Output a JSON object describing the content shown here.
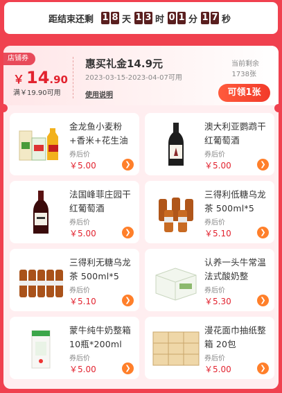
{
  "countdown": {
    "prefix": "距结束还剩",
    "day_digits": [
      "1",
      "8"
    ],
    "day_unit": "天",
    "hour_digits": [
      "1",
      "3"
    ],
    "hour_unit": "时",
    "min_digits": [
      "0",
      "1"
    ],
    "min_unit": "分",
    "sec_digits": [
      "1",
      "7"
    ],
    "sec_unit": "秒"
  },
  "coupon": {
    "tag": "店铺券",
    "currency": "￥",
    "amount_int": "14",
    "amount_dec": ".90",
    "min_use": "满￥19.90可用",
    "title": "惠买礼金14.9元",
    "date_range": "2023-03-15-2023-04-07可用",
    "usage_link": "使用说明",
    "remain_label": "当前剩余",
    "remain_count": "1738张",
    "claim_label": "可领1张"
  },
  "products": [
    {
      "name": "金龙鱼小麦粉+香米+花生油",
      "price_label": "券后价",
      "price": "￥5.00",
      "icon": "grain-oil-bundle"
    },
    {
      "name": "澳大利亚鹦鹉干红葡萄酒",
      "price_label": "券后价",
      "price": "￥5.00",
      "icon": "wine-bottle"
    },
    {
      "name": "法国峰菲庄园干红葡萄酒",
      "price_label": "券后价",
      "price": "￥5.00",
      "icon": "wine-bottle"
    },
    {
      "name": "三得利低糖乌龙茶 500ml*5",
      "price_label": "券后价",
      "price": "￥5.10",
      "icon": "tea-bottles"
    },
    {
      "name": "三得利无糖乌龙茶 500ml*5",
      "price_label": "券后价",
      "price": "￥5.10",
      "icon": "tea-bottles"
    },
    {
      "name": "认养一头牛常温法式酸奶整",
      "price_label": "券后价",
      "price": "￥5.30",
      "icon": "yogurt-box"
    },
    {
      "name": "蒙牛纯牛奶整箱 10瓶*200ml",
      "price_label": "券后价",
      "price": "￥5.00",
      "icon": "milk-box"
    },
    {
      "name": "漫花面巾抽纸整箱 20包",
      "price_label": "券后价",
      "price": "￥5.00",
      "icon": "tissue-pack"
    }
  ],
  "colors": {
    "page_bg": "#f0414f",
    "accent_red": "#e2232f",
    "go_button": "#ff7f2a"
  }
}
